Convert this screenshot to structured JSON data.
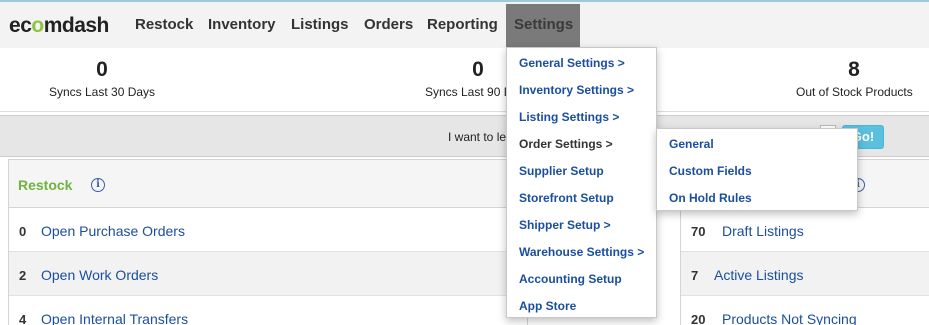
{
  "nav": {
    "logo": "ecomdash",
    "items": [
      "Restock",
      "Inventory",
      "Listings",
      "Orders",
      "Reporting"
    ],
    "active": "Settings"
  },
  "stats": [
    {
      "value": "0",
      "label": "Syncs Last 30 Days"
    },
    {
      "value": "0",
      "label": "Syncs Last 90 D"
    },
    {
      "value": "8",
      "label": "Out of Stock Products"
    }
  ],
  "search": {
    "prompt": "I want to le",
    "go_label": "Go!"
  },
  "restock": {
    "title": "Restock",
    "rows": [
      {
        "count": "0",
        "label": "Open Purchase Orders"
      },
      {
        "count": "2",
        "label": "Open Work Orders"
      },
      {
        "count": "4",
        "label": "Open Internal Transfers"
      }
    ]
  },
  "listings": {
    "rows": [
      {
        "count": "70",
        "label": "Draft Listings"
      },
      {
        "count": "7",
        "label": "Active Listings"
      },
      {
        "count": "20",
        "label": "Products Not Syncing"
      }
    ]
  },
  "settings_menu": {
    "items": [
      "General Settings >",
      "Inventory Settings >",
      "Listing Settings >",
      "Order Settings >",
      "Supplier Setup",
      "Storefront Setup",
      "Shipper Setup >",
      "Warehouse Settings >",
      "Accounting Setup",
      "App Store"
    ],
    "active_index": 3
  },
  "order_submenu": {
    "items": [
      "General",
      "Custom Fields",
      "On Hold Rules"
    ]
  },
  "colors": {
    "accent_green": "#6fb43f",
    "link_blue": "#1a4e9e",
    "go_button": "#5bc0de"
  }
}
